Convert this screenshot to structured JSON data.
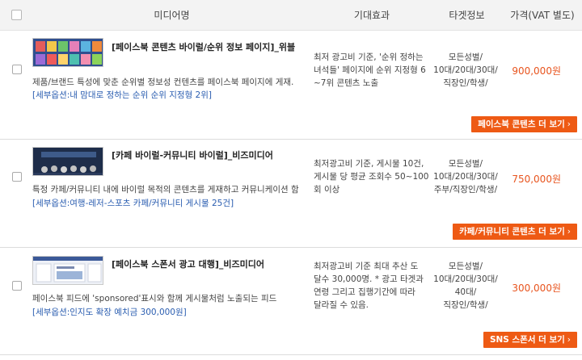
{
  "header": {
    "media_name": "미디어명",
    "expected_effect": "기대효과",
    "target_info": "타겟정보",
    "price": "가격(VAT 별도)"
  },
  "rows": [
    {
      "title": "[페이스북 콘텐츠 바이럴/순위 정보 페이지]_위블",
      "desc": "제품/브랜드 특성에 맞춘 순위별 정보성 컨텐츠를 페이스북 페이지에 게재.",
      "option": "[세부옵션:내 맘대로 정하는 순위 순위 지정형 2위]",
      "effect": [
        "최저 광고비 기준, '순위 정하는",
        "녀석들' 페이지에 순위 지정형 6",
        "~7위 콘텐츠 노출"
      ],
      "target": [
        "모든성별/",
        "10대/20대/30대/",
        "직장인/학생/"
      ],
      "price": "900,000원",
      "button": "페이스북 콘텐츠 더 보기",
      "thumb_icon": "facebook-grid-thumbnail"
    },
    {
      "title": "[카페 바이럴-커뮤니티 바이럴]_비즈미디어",
      "desc": "특정 카페/커뮤니티 내에 바이럴 목적의 콘텐츠를 게재하고 커뮤니케이션 함",
      "option": "[세부옵션:여행-레저-스포츠 카페/커뮤니티 게시물 25건]",
      "effect": [
        "최저광고비 기준, 게시물 10건,",
        "게시물 당 평균 조회수 50~100",
        "회 이상"
      ],
      "target": [
        "모든성별/",
        "10대/20대/30대/",
        "주부/직장인/학생/"
      ],
      "price": "750,000원",
      "button": "카페/커뮤니티 콘텐츠 더 보기",
      "thumb_icon": "cafe-thumbnail"
    },
    {
      "title": "[페이스북 스폰서 광고 대행]_비즈미디어",
      "desc": "페이스북 피드에 'sponsored'표시와 함께 게시물처럼 노출되는 피드",
      "option": "[세부옵션:인지도 확장 예치금 300,000원]",
      "effect": [
        "최저광고비 기준 최대 추산 도",
        "달수 30,000명. * 광고 타겟과",
        "연령 그리고 집행기간에 따라",
        "달라질 수 있음."
      ],
      "target": [
        "모든성별/",
        "10대/20대/30대/",
        "40대/",
        "직장인/학생/"
      ],
      "price": "300,000원",
      "button": "SNS 스폰서 더 보기",
      "thumb_icon": "sponsored-feed-thumbnail"
    }
  ],
  "colors": {
    "accent": "#ee5a14",
    "price": "#e8541e",
    "option_link": "#2a5db0",
    "header_bg": "#f3f3f3"
  }
}
